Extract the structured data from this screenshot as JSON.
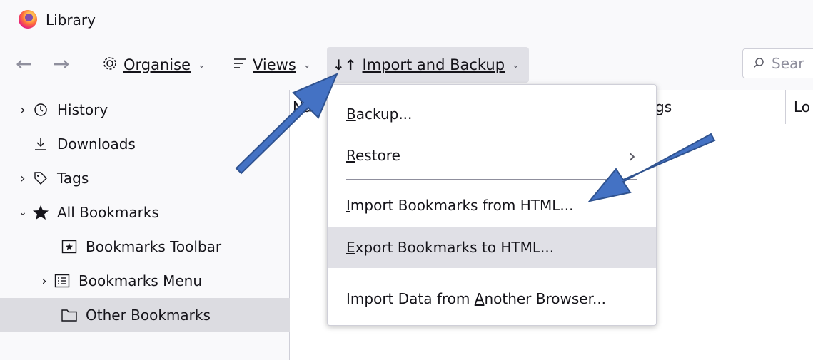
{
  "window": {
    "title": "Library"
  },
  "toolbar": {
    "organise_label": "Organise",
    "views_label": "Views",
    "import_backup_label": "Import and Backup",
    "search_placeholder": "Sear"
  },
  "sidebar": {
    "items": [
      {
        "label": "History",
        "icon": "clock-icon",
        "twisty": "collapsed"
      },
      {
        "label": "Downloads",
        "icon": "download-icon",
        "twisty": "none"
      },
      {
        "label": "Tags",
        "icon": "tag-icon",
        "twisty": "collapsed"
      },
      {
        "label": "All Bookmarks",
        "icon": "star-icon",
        "twisty": "expanded"
      },
      {
        "label": "Bookmarks Toolbar",
        "icon": "bookmarks-toolbar-icon",
        "twisty": "none"
      },
      {
        "label": "Bookmarks Menu",
        "icon": "bookmarks-menu-icon",
        "twisty": "collapsed"
      },
      {
        "label": "Other Bookmarks",
        "icon": "folder-icon",
        "twisty": "none",
        "selected": true
      }
    ]
  },
  "content": {
    "columns": [
      "Nan",
      "gs",
      "Lo"
    ]
  },
  "menu": {
    "items": [
      {
        "label": "Backup...",
        "mnemonic": "B"
      },
      {
        "label": "Restore",
        "mnemonic": "R",
        "submenu": true
      },
      {
        "label": "Import Bookmarks from HTML...",
        "mnemonic": "I"
      },
      {
        "label": "Export Bookmarks to HTML...",
        "mnemonic": "E",
        "highlighted": true
      },
      {
        "label": "Import Data from Another Browser...",
        "mnemonic": "A"
      }
    ]
  },
  "colors": {
    "annotation_arrow": "#4472c4",
    "annotation_arrow_stroke": "#2f528f"
  }
}
